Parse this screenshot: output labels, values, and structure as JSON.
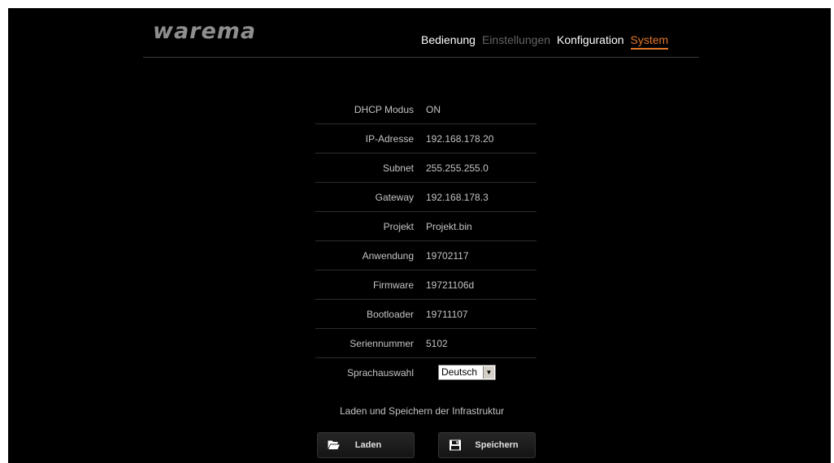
{
  "brand": {
    "logo_text": "warema"
  },
  "nav": {
    "items": [
      {
        "label": "Bedienung",
        "state": "enabled"
      },
      {
        "label": "Einstellungen",
        "state": "disabled"
      },
      {
        "label": "Konfiguration",
        "state": "enabled"
      },
      {
        "label": "System",
        "state": "selected"
      }
    ]
  },
  "system": {
    "rows": [
      {
        "label": "DHCP Modus",
        "value": "ON"
      },
      {
        "label": "IP-Adresse",
        "value": "192.168.178.20"
      },
      {
        "label": "Subnet",
        "value": "255.255.255.0"
      },
      {
        "label": "Gateway",
        "value": "192.168.178.3"
      },
      {
        "label": "Projekt",
        "value": "Projekt.bin"
      },
      {
        "label": "Anwendung",
        "value": "19702117"
      },
      {
        "label": "Firmware",
        "value": "19721106d"
      },
      {
        "label": "Bootloader",
        "value": "19711107"
      },
      {
        "label": "Seriennummer",
        "value": "5102"
      }
    ],
    "language": {
      "label": "Sprachauswahl",
      "selected": "Deutsch"
    }
  },
  "infrastructure": {
    "title": "Laden und Speichern der Infrastruktur",
    "load_label": "Laden",
    "save_label": "Speichern"
  },
  "colors": {
    "accent": "#e2772a",
    "background": "#000000",
    "text": "#c4c4c4",
    "nav_disabled": "#646464"
  },
  "icons": {
    "load": "folder-open-icon",
    "save": "floppy-disk-icon",
    "dropdown": "dropdown-arrow-icon"
  }
}
